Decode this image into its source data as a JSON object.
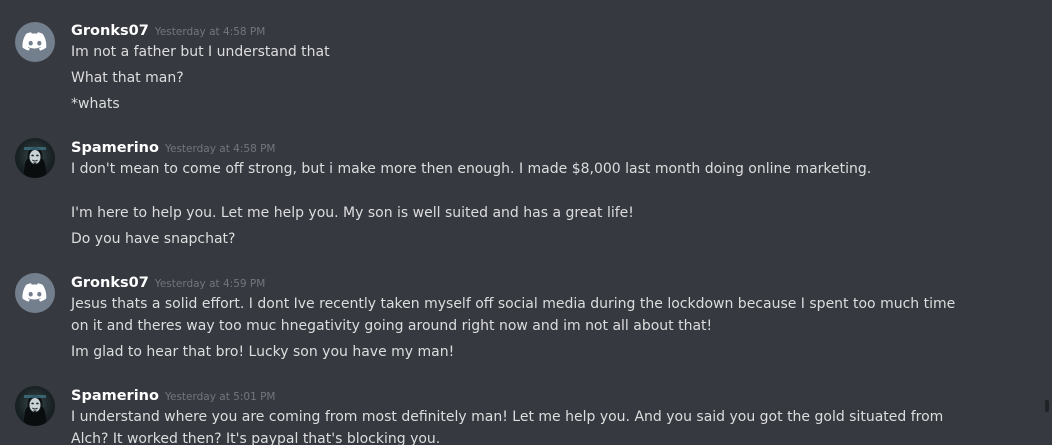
{
  "messages": [
    {
      "username": "Gronks07",
      "timestamp": "Yesterday at 4:58 PM",
      "avatar_icon": "discord-logo-icon",
      "lines": [
        "Im not a father but I understand that",
        "What that man?",
        "*whats"
      ]
    },
    {
      "username": "Spamerino",
      "timestamp": "Yesterday at 4:58 PM",
      "avatar_icon": "masked-figure-avatar",
      "lines": [
        "I don't mean to come off strong, but i make more then enough. I made $8,000 last month doing online marketing.",
        "I'm here to help you. Let me help you. My son is well suited and has a great life!",
        "Do you have snapchat?"
      ]
    },
    {
      "username": "Gronks07",
      "timestamp": "Yesterday at 4:59 PM",
      "avatar_icon": "discord-logo-icon",
      "lines": [
        "Jesus thats a solid effort. I dont Ive recently taken myself off social media during the lockdown because I spent too much time on it and theres way too muc hnegativity going around right now and im not all about that!",
        "Im glad to hear that bro! Lucky son you have my man!"
      ]
    },
    {
      "username": "Spamerino",
      "timestamp": "Yesterday at 5:01 PM",
      "avatar_icon": "masked-figure-avatar",
      "lines": [
        "I understand where you are coming from most definitely man! Let me help you. And you said you got the gold situated from Alch? It worked then? It's paypal that's blocking you."
      ]
    }
  ],
  "colors": {
    "background": "#36393f",
    "username": "#ffffff",
    "timestamp": "#72767d",
    "text": "#dcddde",
    "discord_avatar": "#747f8d"
  }
}
